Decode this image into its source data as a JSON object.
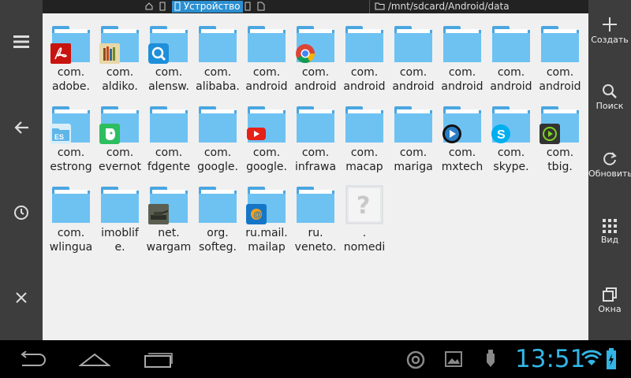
{
  "topbar": {
    "device_tab": "Устройство",
    "path": "/mnt/sdcard/Android/data"
  },
  "right_actions": {
    "create": "Создать",
    "search": "Поиск",
    "refresh": "Обновить",
    "view": "Вид",
    "windows": "Окна"
  },
  "items": [
    {
      "l1": "com.",
      "l2": "adobe.",
      "icon": "pdf-icon"
    },
    {
      "l1": "com.",
      "l2": "aldiko.",
      "icon": "books-icon"
    },
    {
      "l1": "com.",
      "l2": "alensw.",
      "icon": "image-viewer-icon"
    },
    {
      "l1": "com.",
      "l2": "alibaba."
    },
    {
      "l1": "com.",
      "l2": "android"
    },
    {
      "l1": "com.",
      "l2": "android",
      "icon": "chrome-icon"
    },
    {
      "l1": "com.",
      "l2": "android"
    },
    {
      "l1": "com.",
      "l2": "android"
    },
    {
      "l1": "com.",
      "l2": "android"
    },
    {
      "l1": "com.",
      "l2": "android"
    },
    {
      "l1": "com.",
      "l2": "android"
    },
    {
      "l1": "com.",
      "l2": "estrong",
      "icon": "es-explorer-icon"
    },
    {
      "l1": "com.",
      "l2": "evernot",
      "icon": "evernote-icon"
    },
    {
      "l1": "com.",
      "l2": "fdgente"
    },
    {
      "l1": "com.",
      "l2": "google."
    },
    {
      "l1": "com.",
      "l2": "google.",
      "icon": "youtube-icon"
    },
    {
      "l1": "com.",
      "l2": "infrawa"
    },
    {
      "l1": "com.",
      "l2": "macap"
    },
    {
      "l1": "com.",
      "l2": "mariga"
    },
    {
      "l1": "com.",
      "l2": "mxtech",
      "icon": "mx-player-icon"
    },
    {
      "l1": "com.",
      "l2": "skype.",
      "icon": "skype-icon"
    },
    {
      "l1": "com.",
      "l2": "tbig.",
      "icon": "media-player-icon"
    },
    {
      "l1": "com.",
      "l2": "wlingua"
    },
    {
      "l1": "imoblif",
      "l2": "e."
    },
    {
      "l1": "net.",
      "l2": "wargam",
      "icon": "tank-game-icon"
    },
    {
      "l1": "org.",
      "l2": "softeg."
    },
    {
      "l1": "ru.mail.",
      "l2": "mailap",
      "icon": "mail-icon"
    },
    {
      "l1": "ru.",
      "l2": "veneto."
    },
    {
      "l1": ".",
      "l2": "nomedi",
      "icon": "unknown-file-icon"
    }
  ],
  "status": {
    "time": "13:51"
  },
  "colors": {
    "accent": "#33b5e5",
    "folder": "#6ec2f2",
    "sidebar": "#3d3d3d"
  }
}
